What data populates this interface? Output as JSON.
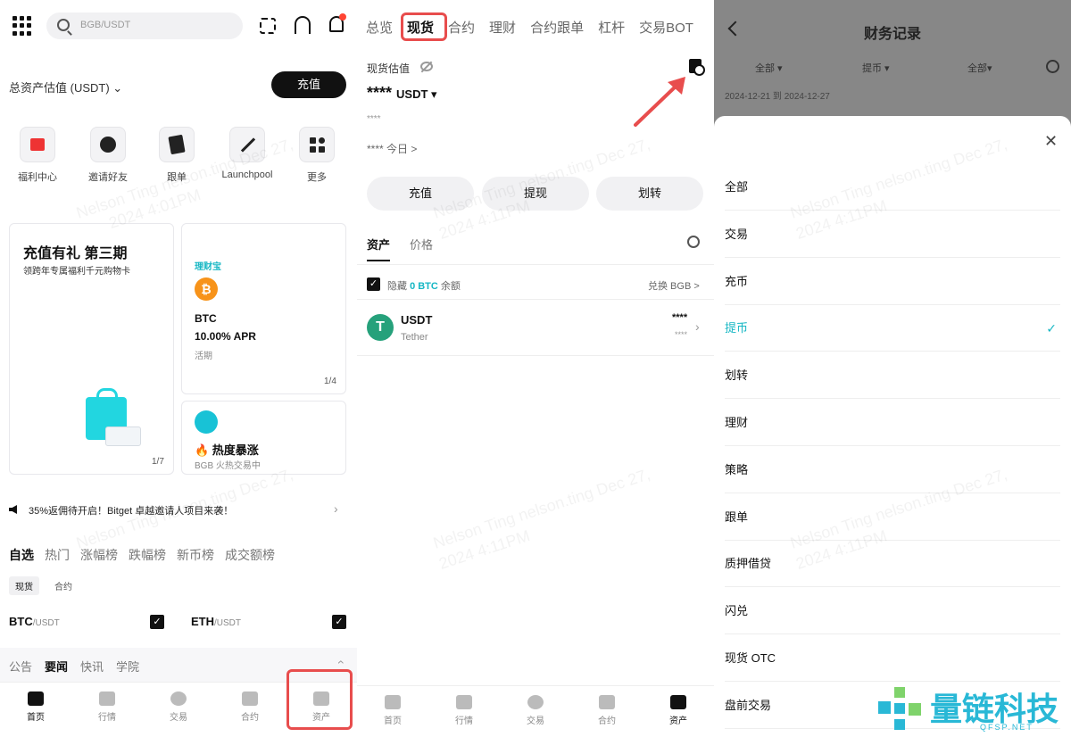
{
  "p1": {
    "search_placeholder": "BGB/USDT",
    "total_assets_label": "总资产估值 (USDT) ⌄",
    "deposit": "充值",
    "shortcuts": [
      {
        "label": "福利中心",
        "icon": "gift-icon"
      },
      {
        "label": "邀请好友",
        "icon": "invite-icon"
      },
      {
        "label": "跟单",
        "icon": "copy-trade-icon"
      },
      {
        "label": "Launchpool",
        "icon": "launchpool-icon"
      },
      {
        "label": "更多",
        "icon": "more-icon"
      }
    ],
    "promo": {
      "title": "充值有礼 第三期",
      "subtitle": "领跨年专属福利千元购物卡",
      "page": "1/7"
    },
    "earn": {
      "label": "理财宝",
      "coin": "BTC",
      "apr": "10.00% APR",
      "term": "活期",
      "page": "1/4"
    },
    "hot": {
      "title": "🔥 热度暴涨",
      "subtitle": "BGB 火热交易中"
    },
    "notice": "35%返佣待开启！Bitget 卓越邀请人项目来袭！",
    "market_tabs": [
      "自选",
      "热门",
      "涨幅榜",
      "跌幅榜",
      "新币榜",
      "成交额榜"
    ],
    "sub_tabs": [
      "现货",
      "合约"
    ],
    "pairs": [
      {
        "base": "BTC",
        "quote": "/USDT"
      },
      {
        "base": "ETH",
        "quote": "/USDT"
      }
    ],
    "news_tabs": [
      "公告",
      "要闻",
      "快讯",
      "学院"
    ],
    "nav": [
      "首页",
      "行情",
      "交易",
      "合约",
      "资产"
    ]
  },
  "p2": {
    "tabs": [
      "总览",
      "现货",
      "合约",
      "理财",
      "合约跟单",
      "杠杆",
      "交易BOT"
    ],
    "spot_label": "现货估值",
    "masked_value": "****",
    "currency": "USDT ▾",
    "masked_small": "****",
    "today": "**** 今日 >",
    "actions": [
      "充值",
      "提现",
      "划转"
    ],
    "asset_tabs": [
      "资产",
      "价格"
    ],
    "hide_prefix": "隐藏",
    "hide_amount": "0 BTC",
    "hide_suffix": "余额",
    "convert": "兑换 BGB >",
    "coin": {
      "symbol": "USDT",
      "name": "Tether",
      "balance": "****",
      "value": "****"
    },
    "nav": [
      "首页",
      "行情",
      "交易",
      "合约",
      "资产"
    ]
  },
  "p3": {
    "title": "财务记录",
    "filters": [
      "全部 ▾",
      "提币 ▾",
      "全部▾"
    ],
    "date_range": "2024-12-21 到 2024-12-27",
    "options": [
      "全部",
      "交易",
      "充币",
      "提币",
      "划转",
      "理财",
      "策略",
      "跟单",
      "质押借贷",
      "闪兑",
      "现货 OTC",
      "盘前交易"
    ],
    "selected": "提币"
  },
  "watermarks": [
    "Nelson Ting nelson.ting Dec 27,",
    "2024 4:01PM",
    "2024 4:11PM"
  ],
  "brand": {
    "name": "量链科技",
    "site": "QFSP.NET"
  },
  "colors": {
    "accent": "#17b7c4",
    "highlight": "#e84d4d",
    "primary": "#111111"
  }
}
